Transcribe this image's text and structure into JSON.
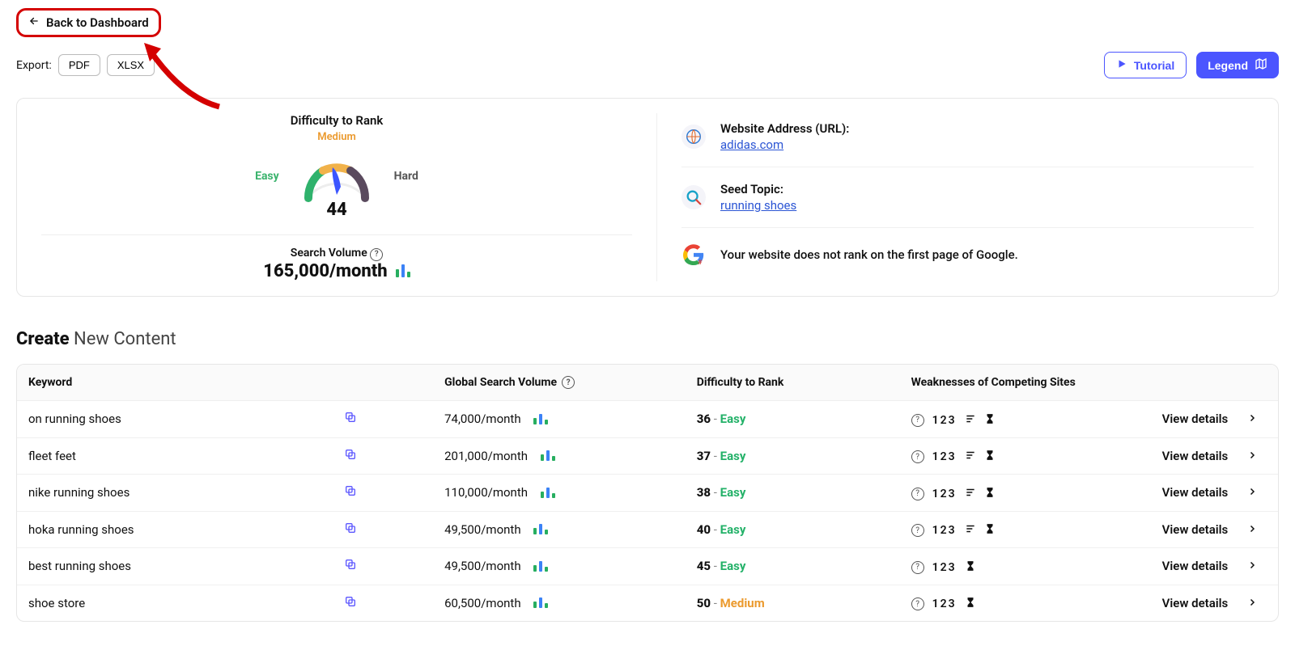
{
  "nav": {
    "back_label": "Back to Dashboard"
  },
  "export": {
    "label": "Export:",
    "pdf": "PDF",
    "xlsx": "XLSX"
  },
  "actions": {
    "tutorial": "Tutorial",
    "legend": "Legend"
  },
  "summary": {
    "difficulty_title": "Difficulty to Rank",
    "medium_label": "Medium",
    "easy_label": "Easy",
    "hard_label": "Hard",
    "difficulty_value": "44",
    "search_volume_label": "Search Volume",
    "search_volume_value": "165,000/month",
    "website_label": "Website Address (URL):",
    "website_value": "adidas.com",
    "topic_label": "Seed Topic:",
    "topic_value": "running shoes",
    "rank_note": "Your website does not rank on the first page of Google."
  },
  "heading": {
    "bold": "Create",
    "rest": "New Content"
  },
  "columns": {
    "keyword": "Keyword",
    "volume": "Global Search Volume",
    "difficulty": "Difficulty to Rank",
    "weaknesses": "Weaknesses of Competing Sites"
  },
  "labels": {
    "view_details": "View details",
    "w123": "123"
  },
  "rows": [
    {
      "keyword": "on running shoes",
      "volume": "74,000/month",
      "diff_num": "36",
      "diff_lbl": "Easy",
      "diff_cls": "easy",
      "extra_icon": true
    },
    {
      "keyword": "fleet feet",
      "volume": "201,000/month",
      "diff_num": "37",
      "diff_lbl": "Easy",
      "diff_cls": "easy",
      "extra_icon": true
    },
    {
      "keyword": "nike running shoes",
      "volume": "110,000/month",
      "diff_num": "38",
      "diff_lbl": "Easy",
      "diff_cls": "easy",
      "extra_icon": true
    },
    {
      "keyword": "hoka running shoes",
      "volume": "49,500/month",
      "diff_num": "40",
      "diff_lbl": "Easy",
      "diff_cls": "easy",
      "extra_icon": true
    },
    {
      "keyword": "best running shoes",
      "volume": "49,500/month",
      "diff_num": "45",
      "diff_lbl": "Easy",
      "diff_cls": "easy",
      "extra_icon": false
    },
    {
      "keyword": "shoe store",
      "volume": "60,500/month",
      "diff_num": "50",
      "diff_lbl": "Medium",
      "diff_cls": "medium",
      "extra_icon": false
    }
  ],
  "chart_data": {
    "type": "bar",
    "title": "Difficulty to Rank",
    "categories": [
      "Easy",
      "Medium",
      "Hard"
    ],
    "value": 44,
    "range": [
      0,
      100
    ]
  }
}
